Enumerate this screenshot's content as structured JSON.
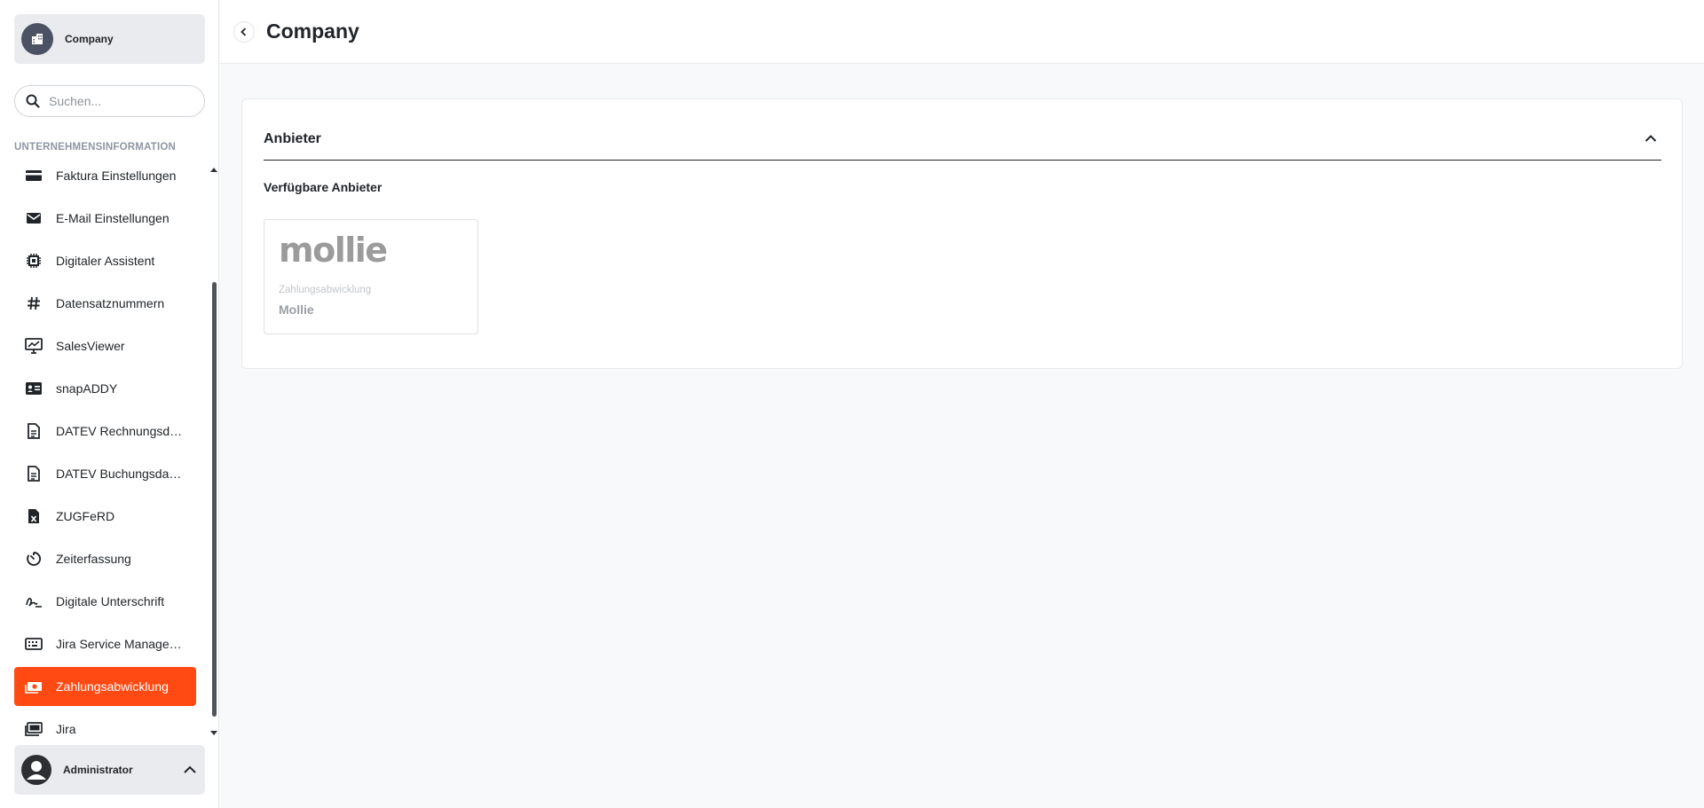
{
  "sidebar": {
    "company_name": "Company",
    "search_placeholder": "Suchen...",
    "section_label": "UNTERNEHMENSINFORMATION",
    "items": [
      {
        "label": "Faktura Einstellungen",
        "icon": "credit-card-icon",
        "active": false
      },
      {
        "label": "E-Mail Einstellungen",
        "icon": "envelope-icon",
        "active": false
      },
      {
        "label": "Digitaler Assistent",
        "icon": "chip-icon",
        "active": false
      },
      {
        "label": "Datensatznummern",
        "icon": "hashtag-icon",
        "active": false
      },
      {
        "label": "SalesViewer",
        "icon": "monitor-chart-icon",
        "active": false
      },
      {
        "label": "snapADDY",
        "icon": "id-card-icon",
        "active": false
      },
      {
        "label": "DATEV Rechnungsdaten",
        "icon": "document-icon",
        "active": false
      },
      {
        "label": "DATEV Buchungsdaten",
        "icon": "document-icon",
        "active": false
      },
      {
        "label": "ZUGFeRD",
        "icon": "excel-file-icon",
        "active": false
      },
      {
        "label": "Zeiterfassung",
        "icon": "timer-icon",
        "active": false
      },
      {
        "label": "Digitale Unterschrift",
        "icon": "signature-icon",
        "active": false
      },
      {
        "label": "Jira Service Management",
        "icon": "keyboard-icon",
        "active": false
      },
      {
        "label": "Zahlungsabwicklung",
        "icon": "money-icon",
        "active": true
      },
      {
        "label": "Jira",
        "icon": "stack-icon",
        "active": false
      }
    ],
    "user_name": "Administrator"
  },
  "header": {
    "title": "Company"
  },
  "panel": {
    "title": "Anbieter",
    "subtitle": "Verfügbare Anbieter",
    "providers": [
      {
        "logo_text": "mollie",
        "category": "Zahlungsabwicklung",
        "name": "Mollie"
      }
    ]
  },
  "colors": {
    "accent": "#ff4a14",
    "sidebar_box": "#e9ebee",
    "background": "#f8f9fa"
  }
}
